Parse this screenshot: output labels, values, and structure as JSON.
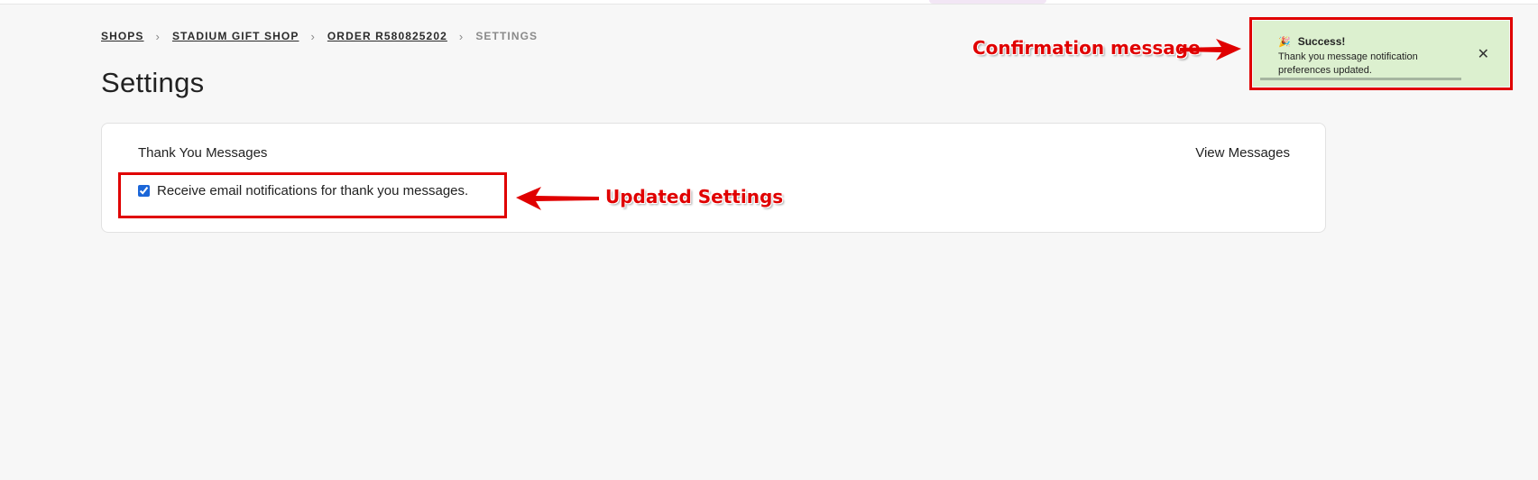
{
  "breadcrumb": {
    "items": [
      "SHOPS",
      "STADIUM GIFT SHOP",
      "ORDER R580825202"
    ],
    "current": "SETTINGS",
    "separator": "›"
  },
  "page": {
    "title": "Settings"
  },
  "card": {
    "title": "Thank You Messages",
    "view_link": "View Messages",
    "checkbox_label": "Receive email notifications for thank you messages.",
    "checkbox_checked": true
  },
  "toast": {
    "emoji": "🎉",
    "title": "Success!",
    "message": "Thank you message notification preferences updated.",
    "close": "✕",
    "progress_fraction": 0.93,
    "background": "#dcf0cf"
  },
  "annotations": {
    "toast_label": "Confirmation message",
    "settings_label": "Updated Settings",
    "color": "#e00000"
  }
}
